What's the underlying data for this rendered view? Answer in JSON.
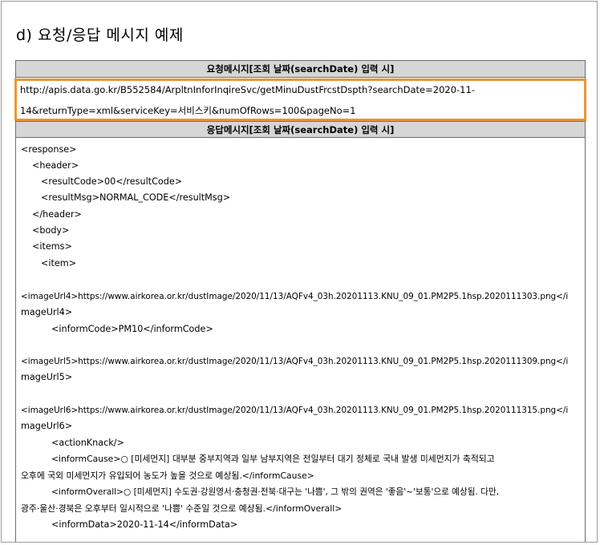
{
  "section_heading": "d)  요청/응답 메시지 예제",
  "request": {
    "header": "요청메시지[조회 날짜(searchDate) 입력 시]",
    "url_lines": [
      "http://apis.data.go.kr/B552584/ArpltnInforInqireSvc/getMinuDustFrcstDspth?searchDate=2020-11-",
      "14&returnType=xml&serviceKey=서비스키&numOfRows=100&pageNo=1"
    ]
  },
  "response": {
    "header": "응답메시지[조회 날짜(searchDate) 입력 시]",
    "lines": [
      "<response>",
      "<header>",
      "<resultCode>00</resultCode>",
      "<resultMsg>NORMAL_CODE</resultMsg>",
      "</header>",
      "<body>",
      "<items>",
      "<item>",
      "<imageUrl4>https://www.airkorea.or.kr/dustImage/2020/11/13/AQFv4_03h.20201113.KNU_09_01.PM2P5.1hsp.2020111303.png</i",
      "mageUrl4>",
      "<informCode>PM10</informCode>",
      "<imageUrl5>https://www.airkorea.or.kr/dustImage/2020/11/13/AQFv4_03h.20201113.KNU_09_01.PM2P5.1hsp.2020111309.png</i",
      "mageUrl5>",
      "<imageUrl6>https://www.airkorea.or.kr/dustImage/2020/11/13/AQFv4_03h.20201113.KNU_09_01.PM2P5.1hsp.2020111315.png</i",
      "mageUrl6>",
      "<actionKnack/>",
      "<informCause>○ [미세먼지] 대부분 중부지역과 일부 남부지역은 전일부터 대기 정체로 국내 발생 미세먼지가 축적되고",
      "오후에 국외 미세먼지가 유입되어 농도가 높을 것으로 예상됨.</informCause>",
      "<informOverall>○ [미세먼지] 수도권·강원영서·충청권·전북·대구는 '나쁨', 그 밖의 권역은 '좋음'~'보통'으로 예상됨. 다만,",
      "광주·울산·경북은 오후부터 일시적으로 '나쁨' 수준일 것으로 예상됨.</informOverall>",
      "<informData>2020-11-14</informData>"
    ]
  }
}
